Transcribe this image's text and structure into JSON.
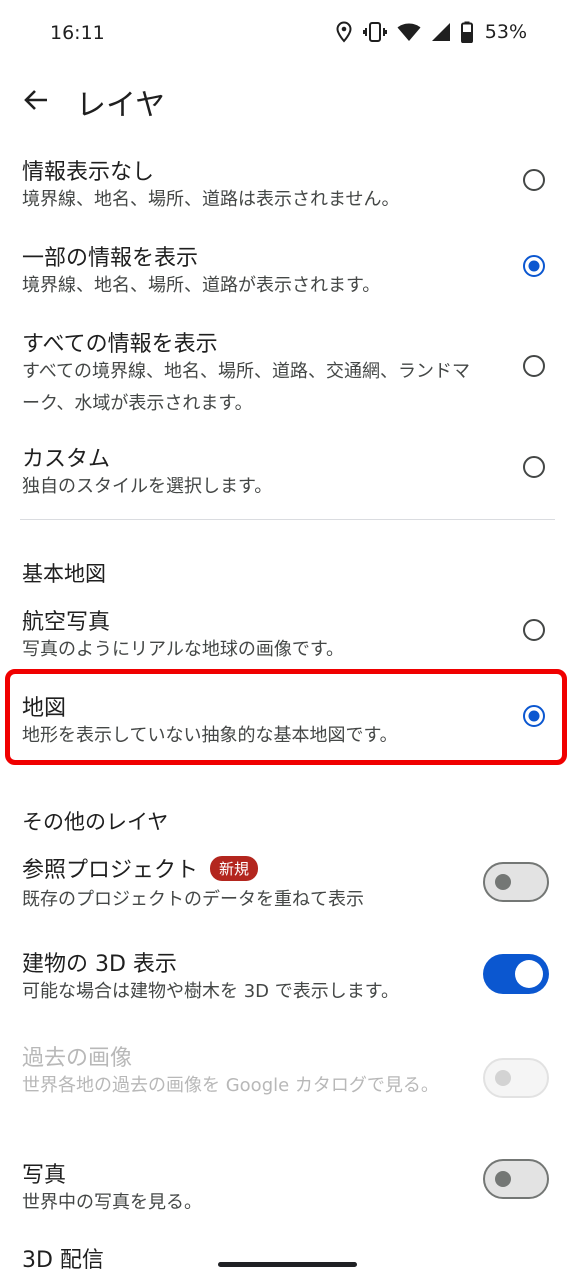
{
  "status": {
    "time": "16:11",
    "battery": "53%"
  },
  "header": {
    "title": "レイヤ"
  },
  "map_type": [
    {
      "title": "情報表示なし",
      "subtitle": "境界線、地名、場所、道路は表示されません。",
      "selected": false
    },
    {
      "title": "一部の情報を表示",
      "subtitle": "境界線、地名、場所、道路が表示されます。",
      "selected": true
    },
    {
      "title": "すべての情報を表示",
      "subtitle": "すべての境界線、地名、場所、道路、交通網、ランドマーク、水域が表示されます。",
      "selected": false
    },
    {
      "title": "カスタム",
      "subtitle": "独自のスタイルを選択します。",
      "selected": false
    }
  ],
  "base_map": {
    "heading": "基本地図",
    "items": [
      {
        "title": "航空写真",
        "subtitle": "写真のようにリアルな地球の画像です。",
        "selected": false
      },
      {
        "title": "地図",
        "subtitle": "地形を表示していない抽象的な基本地図です。",
        "selected": true
      }
    ]
  },
  "other_layers": {
    "heading": "その他のレイヤ",
    "items": [
      {
        "title": "参照プロジェクト",
        "badge": "新規",
        "subtitle": "既存のプロジェクトのデータを重ねて表示",
        "state": "off"
      },
      {
        "title": "建物の 3D 表示",
        "subtitle": "可能な場合は建物や樹木を 3D で表示します。",
        "state": "on"
      },
      {
        "title": "過去の画像",
        "subtitle": "世界各地の過去の画像を Google カタログで見る。",
        "state": "disabled"
      },
      {
        "title": "写真",
        "subtitle": "世界中の写真を見る。",
        "state": "off"
      },
      {
        "title": "3D 配信",
        "subtitle": "",
        "state": "off"
      }
    ]
  },
  "colors": {
    "accent": "#0b57d0",
    "highlight": "#f00000"
  }
}
